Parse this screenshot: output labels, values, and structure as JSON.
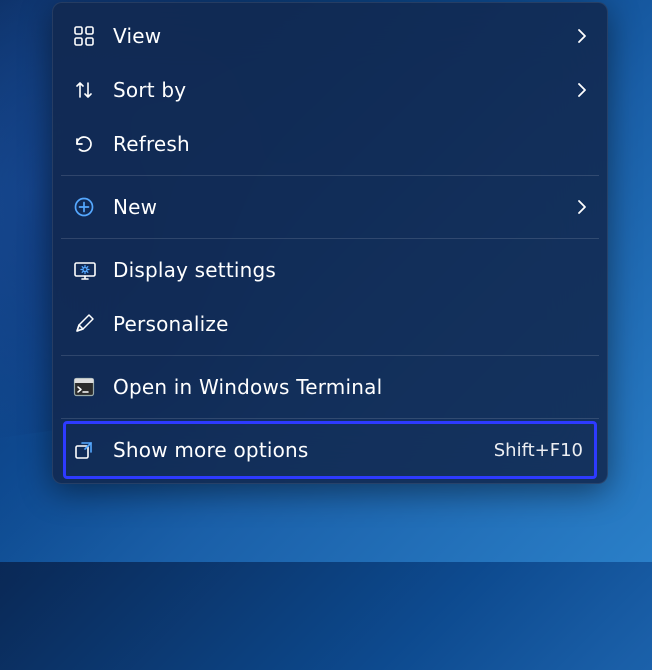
{
  "contextMenu": {
    "items": [
      {
        "label": "View",
        "hasSubmenu": true
      },
      {
        "label": "Sort by",
        "hasSubmenu": true
      },
      {
        "label": "Refresh",
        "hasSubmenu": false
      },
      {
        "label": "New",
        "hasSubmenu": true
      },
      {
        "label": "Display settings",
        "hasSubmenu": false
      },
      {
        "label": "Personalize",
        "hasSubmenu": false
      },
      {
        "label": "Open in Windows Terminal",
        "hasSubmenu": false
      },
      {
        "label": "Show more options",
        "hasSubmenu": false,
        "shortcut": "Shift+F10",
        "highlighted": true
      }
    ]
  }
}
